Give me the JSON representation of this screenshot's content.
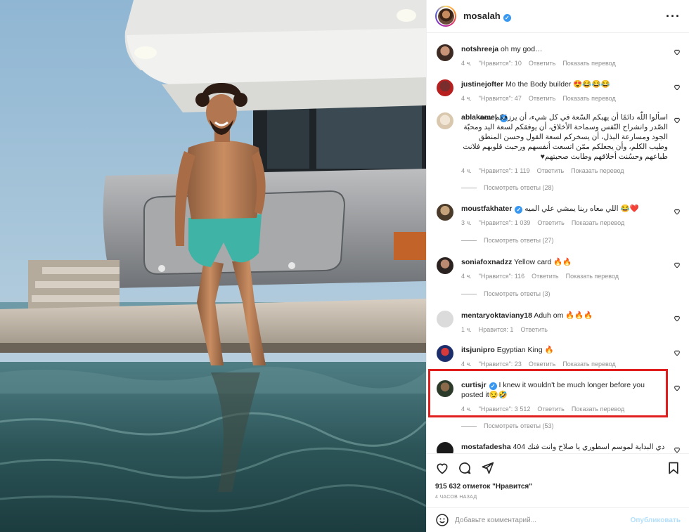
{
  "post": {
    "username": "mosalah",
    "more_icon": "more-horizontal-icon"
  },
  "comments": [
    {
      "user": "notshreeja",
      "text": "oh my god…",
      "time": "4 ч.",
      "likes": "\"Нравится\": 10",
      "reply": "Ответить",
      "translate": "Показать перевод",
      "verified": false,
      "rtl": false
    },
    {
      "user": "justinejofter",
      "text": "Mo the Body builder 😍😂😂😂",
      "time": "4 ч.",
      "likes": "\"Нравится\": 47",
      "reply": "Ответить",
      "translate": "Показать перевод",
      "verified": false,
      "rtl": false
    },
    {
      "user": "ablakamel",
      "text": "اسألوا اللّٰه دائمًا أن يهبكم السّعة في كل شيء، أن يرزقكم سعة الصّدر وانشراح النّفس وسماحة الأخلاق، أن يوفقكم لسعة اليد ومحبّة الجود ومسارعة البذل، أن يسخركم لسعة القول وحسن المنطق وطيب الكلم، وأن يجعلكم ممّن اتسعت أنفسهم ورحبت قلوبهم فلانت طباعهم وحسُنت أخلاقهم وطابت صحبتهم♥",
      "time": "4 ч.",
      "likes": "\"Нравится\": 1 119",
      "reply": "Ответить",
      "translate": "Показать перевод",
      "replies": "Посмотреть ответы (28)",
      "verified": true,
      "rtl": true
    },
    {
      "user": "moustfakhater",
      "text": "اللي معاه ربنا يمشي علي الميه 😂❤️",
      "time": "3 ч.",
      "likes": "\"Нравится\": 1 039",
      "reply": "Ответить",
      "translate": "Показать перевод",
      "replies": "Посмотреть ответы (27)",
      "verified": true,
      "rtl": false
    },
    {
      "user": "soniafoxnadzz",
      "text": "Yellow card 🔥🔥",
      "time": "4 ч.",
      "likes": "\"Нравится\": 116",
      "reply": "Ответить",
      "translate": "Показать перевод",
      "replies": "Посмотреть ответы (3)",
      "verified": false,
      "rtl": false
    },
    {
      "user": "mentaryoktaviany18",
      "text": "Aduh om 🔥🔥🔥",
      "time": "1 ч.",
      "likes": "Нравится: 1",
      "reply": "Ответить",
      "translate": "",
      "verified": false,
      "rtl": false
    },
    {
      "user": "itsjunipro",
      "text": "Egyptian King 🔥",
      "time": "4 ч.",
      "likes": "\"Нравится\": 23",
      "reply": "Ответить",
      "translate": "Показать перевод",
      "verified": false,
      "rtl": false
    },
    {
      "user": "curtisjr",
      "text": "I knew it wouldn't be much longer before you posted it😏🤣",
      "time": "4 ч.",
      "likes": "\"Нравится\": 3 512",
      "reply": "Ответить",
      "translate": "Показать перевод",
      "replies": "Посмотреть ответы (53)",
      "verified": true,
      "rtl": false
    },
    {
      "user": "mostafadesha",
      "text": "404 دي البداية لموسم اسطوري يا صلاح وانت فنك",
      "time": "",
      "likes": "",
      "reply": "",
      "translate": "",
      "verified": false,
      "rtl": false
    }
  ],
  "footer": {
    "likes_count": "915 632 отметок \"Нравится\"",
    "time_ago": "4 ЧАСОВ НАЗАД",
    "comment_placeholder": "Добавьте комментарий...",
    "post_label": "Опубликовать"
  },
  "colors": {
    "highlight": "#e01e1e",
    "verified": "#3897f0",
    "link_disabled": "#b2dffc"
  }
}
